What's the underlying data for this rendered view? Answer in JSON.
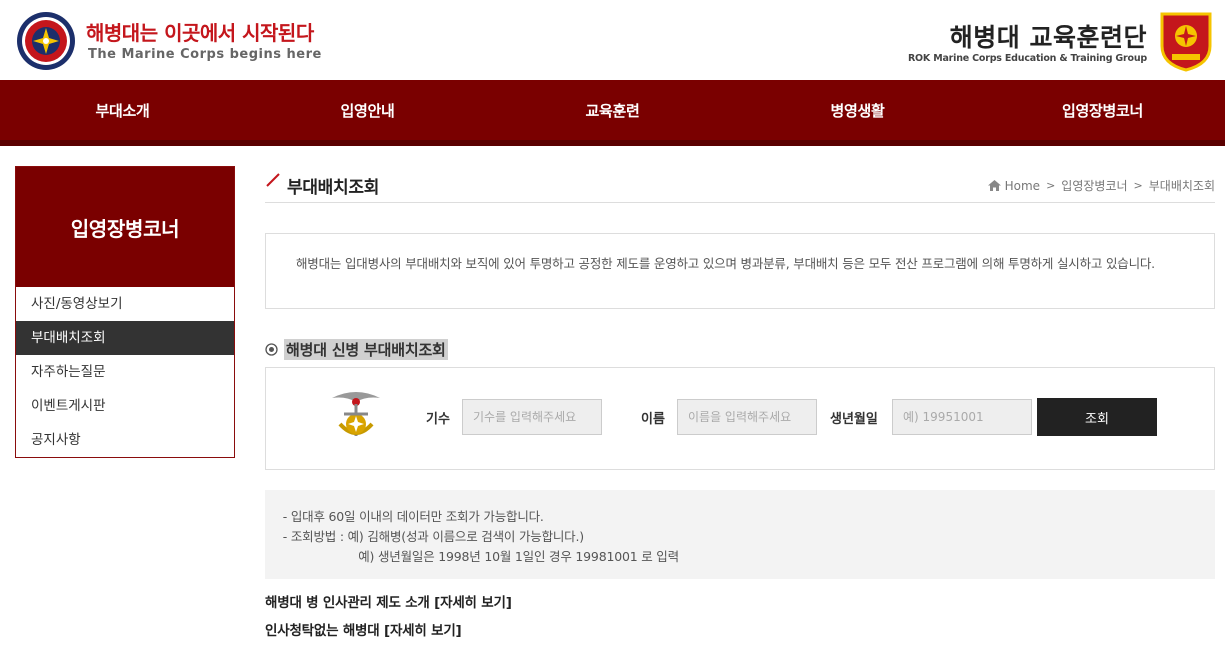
{
  "header": {
    "slogan_kr": "해병대는 이곳에서 시작된다",
    "slogan_en": "The Marine Corps begins here",
    "brand_kr": "해병대 교육훈련단",
    "brand_en": "ROK Marine Corps Education  & Training Group"
  },
  "nav": {
    "items": [
      "부대소개",
      "입영안내",
      "교육훈련",
      "병영생활",
      "입영장병코너"
    ]
  },
  "sidebar": {
    "title": "입영장병코너",
    "items": [
      "사진/동영상보기",
      "부대배치조회",
      "자주하는질문",
      "이벤트게시판",
      "공지사항"
    ],
    "active_index": 1
  },
  "page": {
    "title": "부대배치조회",
    "breadcrumb": [
      "Home",
      "입영장병코너",
      "부대배치조회"
    ],
    "intro": "해병대는 입대병사의 부대배치와 보직에 있어 투명하고 공정한 제도를 운영하고 있으며 병과분류, 부대배치 등은 모두 전산 프로그램에 의해 투명하게 실시하고 있습니다.",
    "section_title": "해병대 신병 부대배치조회"
  },
  "search": {
    "class_label": "기수",
    "class_placeholder": "기수를 입력해주세요",
    "name_label": "이름",
    "name_placeholder": "이름을 입력해주세요",
    "birth_label": "생년월일",
    "birth_placeholder": "예) 19951001",
    "submit_label": "조회"
  },
  "notes": [
    " - 입대후 60일 이내의 데이터만 조회가 가능합니다.",
    " - 조회방법 : 예) 김해병(성과 이름으로 검색이 가능합니다.)",
    "                     예) 생년월일은 1998년 10월 1일인 경우 19981001 로 입력"
  ],
  "links": [
    "해병대 병 인사관리 제도 소개 [자세히 보기]",
    "인사청탁없는 해병대 [자세히 보기]"
  ],
  "colors": {
    "brand_red": "#7a0000",
    "slogan_red": "#c4161c"
  }
}
